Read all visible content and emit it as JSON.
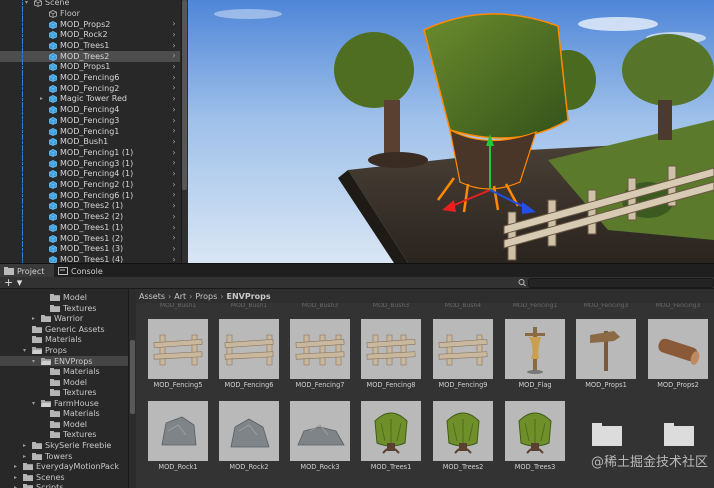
{
  "hierarchy": {
    "items": [
      {
        "label": "Scene",
        "indent": 0,
        "kind": "scene",
        "tri": true
      },
      {
        "label": "Floor",
        "indent": 1,
        "kind": "gray"
      },
      {
        "label": "MOD_Props2",
        "indent": 1,
        "kind": "blue"
      },
      {
        "label": "MOD_Rock2",
        "indent": 1,
        "kind": "blue"
      },
      {
        "label": "MOD_Trees1",
        "indent": 1,
        "kind": "blue"
      },
      {
        "label": "MOD_Trees2",
        "indent": 1,
        "kind": "blue",
        "selected": true
      },
      {
        "label": "MOD_Props1",
        "indent": 1,
        "kind": "blue"
      },
      {
        "label": "MOD_Fencing6",
        "indent": 1,
        "kind": "blue"
      },
      {
        "label": "MOD_Fencing2",
        "indent": 1,
        "kind": "blue"
      },
      {
        "label": "Magic Tower Red",
        "indent": 1,
        "kind": "blue",
        "tri": true
      },
      {
        "label": "MOD_Fencing4",
        "indent": 1,
        "kind": "blue"
      },
      {
        "label": "MOD_Fencing3",
        "indent": 1,
        "kind": "blue"
      },
      {
        "label": "MOD_Fencing1",
        "indent": 1,
        "kind": "blue"
      },
      {
        "label": "MOD_Bush1",
        "indent": 1,
        "kind": "blue"
      },
      {
        "label": "MOD_Fencing1 (1)",
        "indent": 1,
        "kind": "blue"
      },
      {
        "label": "MOD_Fencing3 (1)",
        "indent": 1,
        "kind": "blue"
      },
      {
        "label": "MOD_Fencing4 (1)",
        "indent": 1,
        "kind": "blue"
      },
      {
        "label": "MOD_Fencing2 (1)",
        "indent": 1,
        "kind": "blue"
      },
      {
        "label": "MOD_Fencing6 (1)",
        "indent": 1,
        "kind": "blue"
      },
      {
        "label": "MOD_Trees2 (1)",
        "indent": 1,
        "kind": "blue"
      },
      {
        "label": "MOD_Trees2 (2)",
        "indent": 1,
        "kind": "blue"
      },
      {
        "label": "MOD_Trees1 (1)",
        "indent": 1,
        "kind": "blue"
      },
      {
        "label": "MOD_Trees1 (2)",
        "indent": 1,
        "kind": "blue"
      },
      {
        "label": "MOD_Trees1 (3)",
        "indent": 1,
        "kind": "blue"
      },
      {
        "label": "MOD_Trees1 (4)",
        "indent": 1,
        "kind": "blue"
      }
    ]
  },
  "tabs": {
    "project": "Project",
    "console": "Console"
  },
  "toolbar": {
    "add": "+ ▾"
  },
  "tree": {
    "items": [
      {
        "label": "Model",
        "indent": 4,
        "kind": "folder"
      },
      {
        "label": "Textures",
        "indent": 4,
        "kind": "folder"
      },
      {
        "label": "Warrior",
        "indent": 3,
        "kind": "folder",
        "tri": "▸"
      },
      {
        "label": "Generic Assets",
        "indent": 2,
        "kind": "folder"
      },
      {
        "label": "Materials",
        "indent": 2,
        "kind": "folder"
      },
      {
        "label": "Props",
        "indent": 2,
        "kind": "open",
        "tri": "▾"
      },
      {
        "label": "ENVProps",
        "indent": 3,
        "kind": "open",
        "tri": "▾",
        "selected": true
      },
      {
        "label": "Materials",
        "indent": 4,
        "kind": "folder"
      },
      {
        "label": "Model",
        "indent": 4,
        "kind": "folder"
      },
      {
        "label": "Textures",
        "indent": 4,
        "kind": "folder"
      },
      {
        "label": "FarmHouse",
        "indent": 3,
        "kind": "open",
        "tri": "▾"
      },
      {
        "label": "Materials",
        "indent": 4,
        "kind": "folder"
      },
      {
        "label": "Model",
        "indent": 4,
        "kind": "folder"
      },
      {
        "label": "Textures",
        "indent": 4,
        "kind": "folder"
      },
      {
        "label": "SkySerie Freebie",
        "indent": 2,
        "kind": "folder",
        "tri": "▸"
      },
      {
        "label": "Towers",
        "indent": 2,
        "kind": "folder",
        "tri": "▸"
      },
      {
        "label": "EverydayMotionPack",
        "indent": 1,
        "kind": "folder",
        "tri": "▸"
      },
      {
        "label": "Scenes",
        "indent": 1,
        "kind": "folder",
        "tri": "▸"
      },
      {
        "label": "Scripts",
        "indent": 1,
        "kind": "folder",
        "tri": "▸"
      }
    ]
  },
  "breadcrumb": [
    "Assets",
    "Art",
    "Props",
    "ENVProps"
  ],
  "ghost_labels": [
    "MOD_Bush1",
    "MOD_Bush1",
    "MOD_Bush3",
    "MOD_Bush3",
    "MOD_Bush4",
    "MOD_Fencing1",
    "MOD_Fencing3",
    "MOD_Fencing3"
  ],
  "assets_row1": [
    {
      "label": "MOD_Fencing5",
      "icon": "fence-a"
    },
    {
      "label": "MOD_Fencing6",
      "icon": "fence-b"
    },
    {
      "label": "MOD_Fencing7",
      "icon": "fence-c"
    },
    {
      "label": "MOD_Fencing8",
      "icon": "fence-d"
    },
    {
      "label": "MOD_Fencing9",
      "icon": "fence-e"
    },
    {
      "label": "MOD_Flag",
      "icon": "flag"
    },
    {
      "label": "MOD_Props1",
      "icon": "signpost"
    },
    {
      "label": "MOD_Props2",
      "icon": "log"
    }
  ],
  "assets_row2": [
    {
      "label": "MOD_Rock1",
      "icon": "rock-a"
    },
    {
      "label": "MOD_Rock2",
      "icon": "rock-b"
    },
    {
      "label": "MOD_Rock3",
      "icon": "rock-c"
    },
    {
      "label": "MOD_Trees1",
      "icon": "tree-a"
    },
    {
      "label": "MOD_Trees2",
      "icon": "tree-b"
    },
    {
      "label": "MOD_Trees3",
      "icon": "tree-c"
    },
    {
      "label": "",
      "icon": "folder"
    },
    {
      "label": "",
      "icon": "folder"
    }
  ],
  "watermark": "@稀土掘金技术社区",
  "colors": {
    "selection": "#4d4d4d",
    "cube_blue": "#3b9ede",
    "gizmo_orange": "#ff8a00"
  }
}
